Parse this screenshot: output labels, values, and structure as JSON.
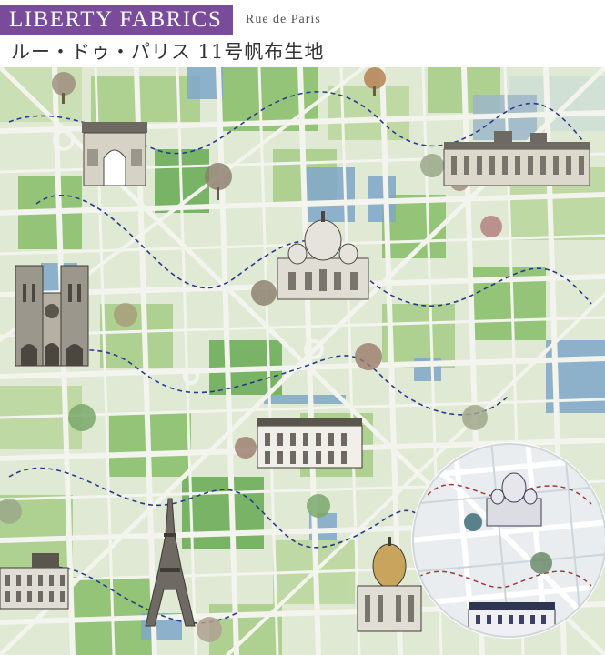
{
  "header": {
    "brand": "LIBERTY FABRICS",
    "collection": "Rue de Paris",
    "product_title": "ルー・ドゥ・パリス 11号帆布生地"
  },
  "colors": {
    "brand_purple": "#7a4b9a",
    "map_green_light": "#d6e6c4",
    "map_green_mid": "#a9cf8c",
    "map_green_dark": "#6fae5a",
    "water_blue": "#7fa7c9",
    "street_white": "#f4f4ee",
    "route_navy": "#2a3a8c",
    "inset_bg": "#e9edf0",
    "inset_route_red": "#a23a3a"
  },
  "landmarks": [
    {
      "name": "arc-de-triomphe",
      "icon": "arch-icon"
    },
    {
      "name": "musee-d-orsay",
      "icon": "museum-icon"
    },
    {
      "name": "sacre-coeur",
      "icon": "basilica-icon"
    },
    {
      "name": "notre-dame",
      "icon": "cathedral-icon"
    },
    {
      "name": "musee-rodin",
      "icon": "mansion-icon"
    },
    {
      "name": "eiffel-tower",
      "icon": "tower-icon"
    },
    {
      "name": "les-invalides",
      "icon": "dome-icon"
    },
    {
      "name": "palais-du-luxembourg",
      "icon": "palace-icon"
    }
  ],
  "inset": {
    "description_icon": "magnified-swatch-icon"
  }
}
